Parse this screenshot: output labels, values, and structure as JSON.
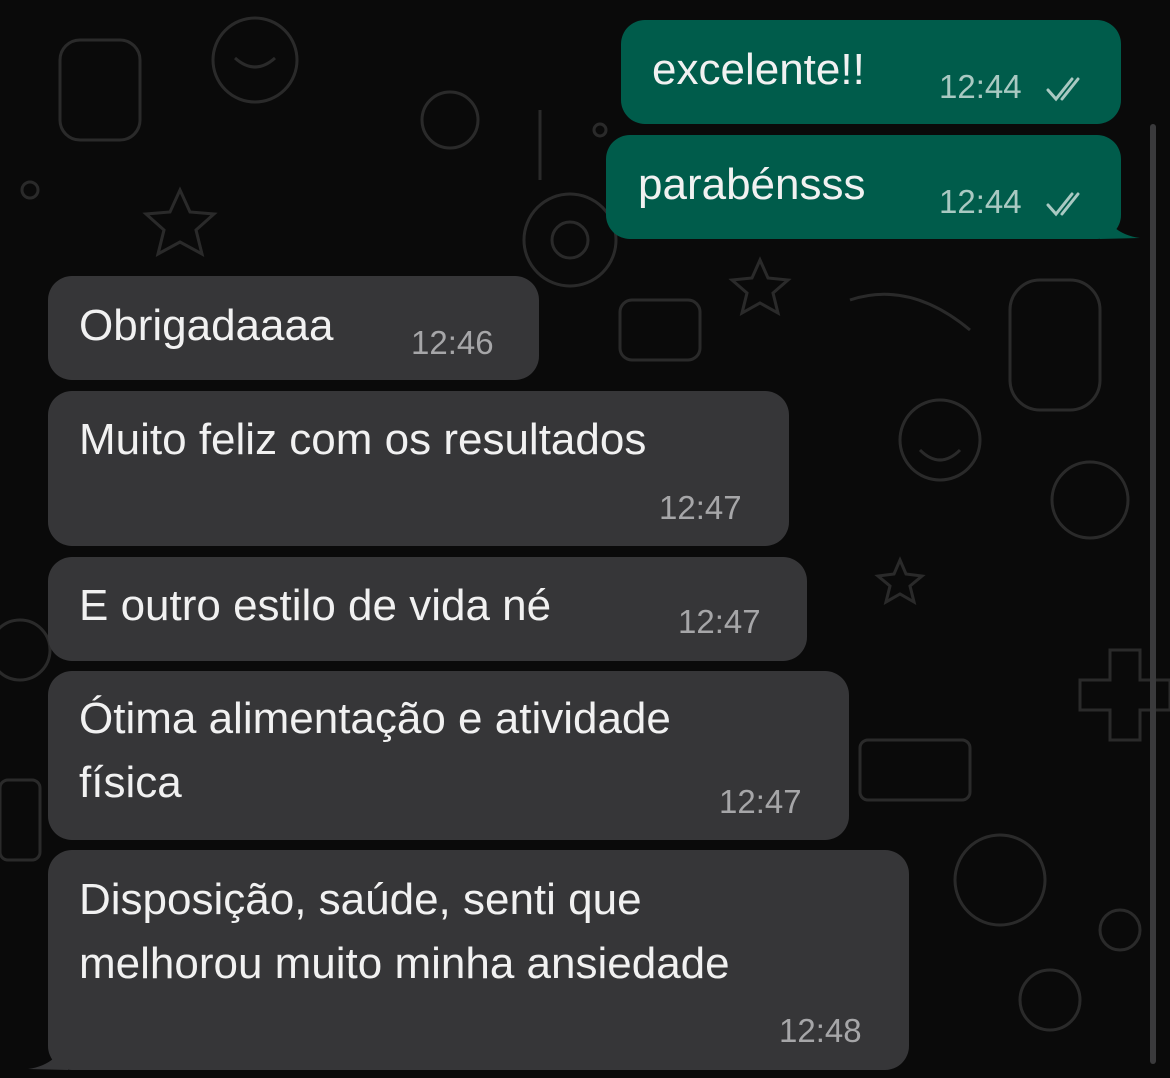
{
  "colors": {
    "background": "#0a0a0a",
    "outgoing_bubble": "#005c4b",
    "incoming_bubble": "#363638",
    "timestamp": "#a6a6a8"
  },
  "messages": [
    {
      "direction": "outgoing",
      "text": "excelente!!",
      "time": "12:44",
      "status": "read-double-check-icon"
    },
    {
      "direction": "outgoing",
      "text": "parabénsss",
      "time": "12:44",
      "status": "read-double-check-icon"
    },
    {
      "direction": "incoming",
      "text": "Obrigadaaaa",
      "time": "12:46"
    },
    {
      "direction": "incoming",
      "text": "Muito feliz com os resultados",
      "time": "12:47"
    },
    {
      "direction": "incoming",
      "text": "E outro estilo de vida né",
      "time": "12:47"
    },
    {
      "direction": "incoming",
      "text": "Ótima alimentação e atividade\nfísica",
      "time": "12:47"
    },
    {
      "direction": "incoming",
      "text": "Disposição, saúde, senti que\nmelhorou muito minha ansiedade",
      "time": "12:48"
    }
  ]
}
